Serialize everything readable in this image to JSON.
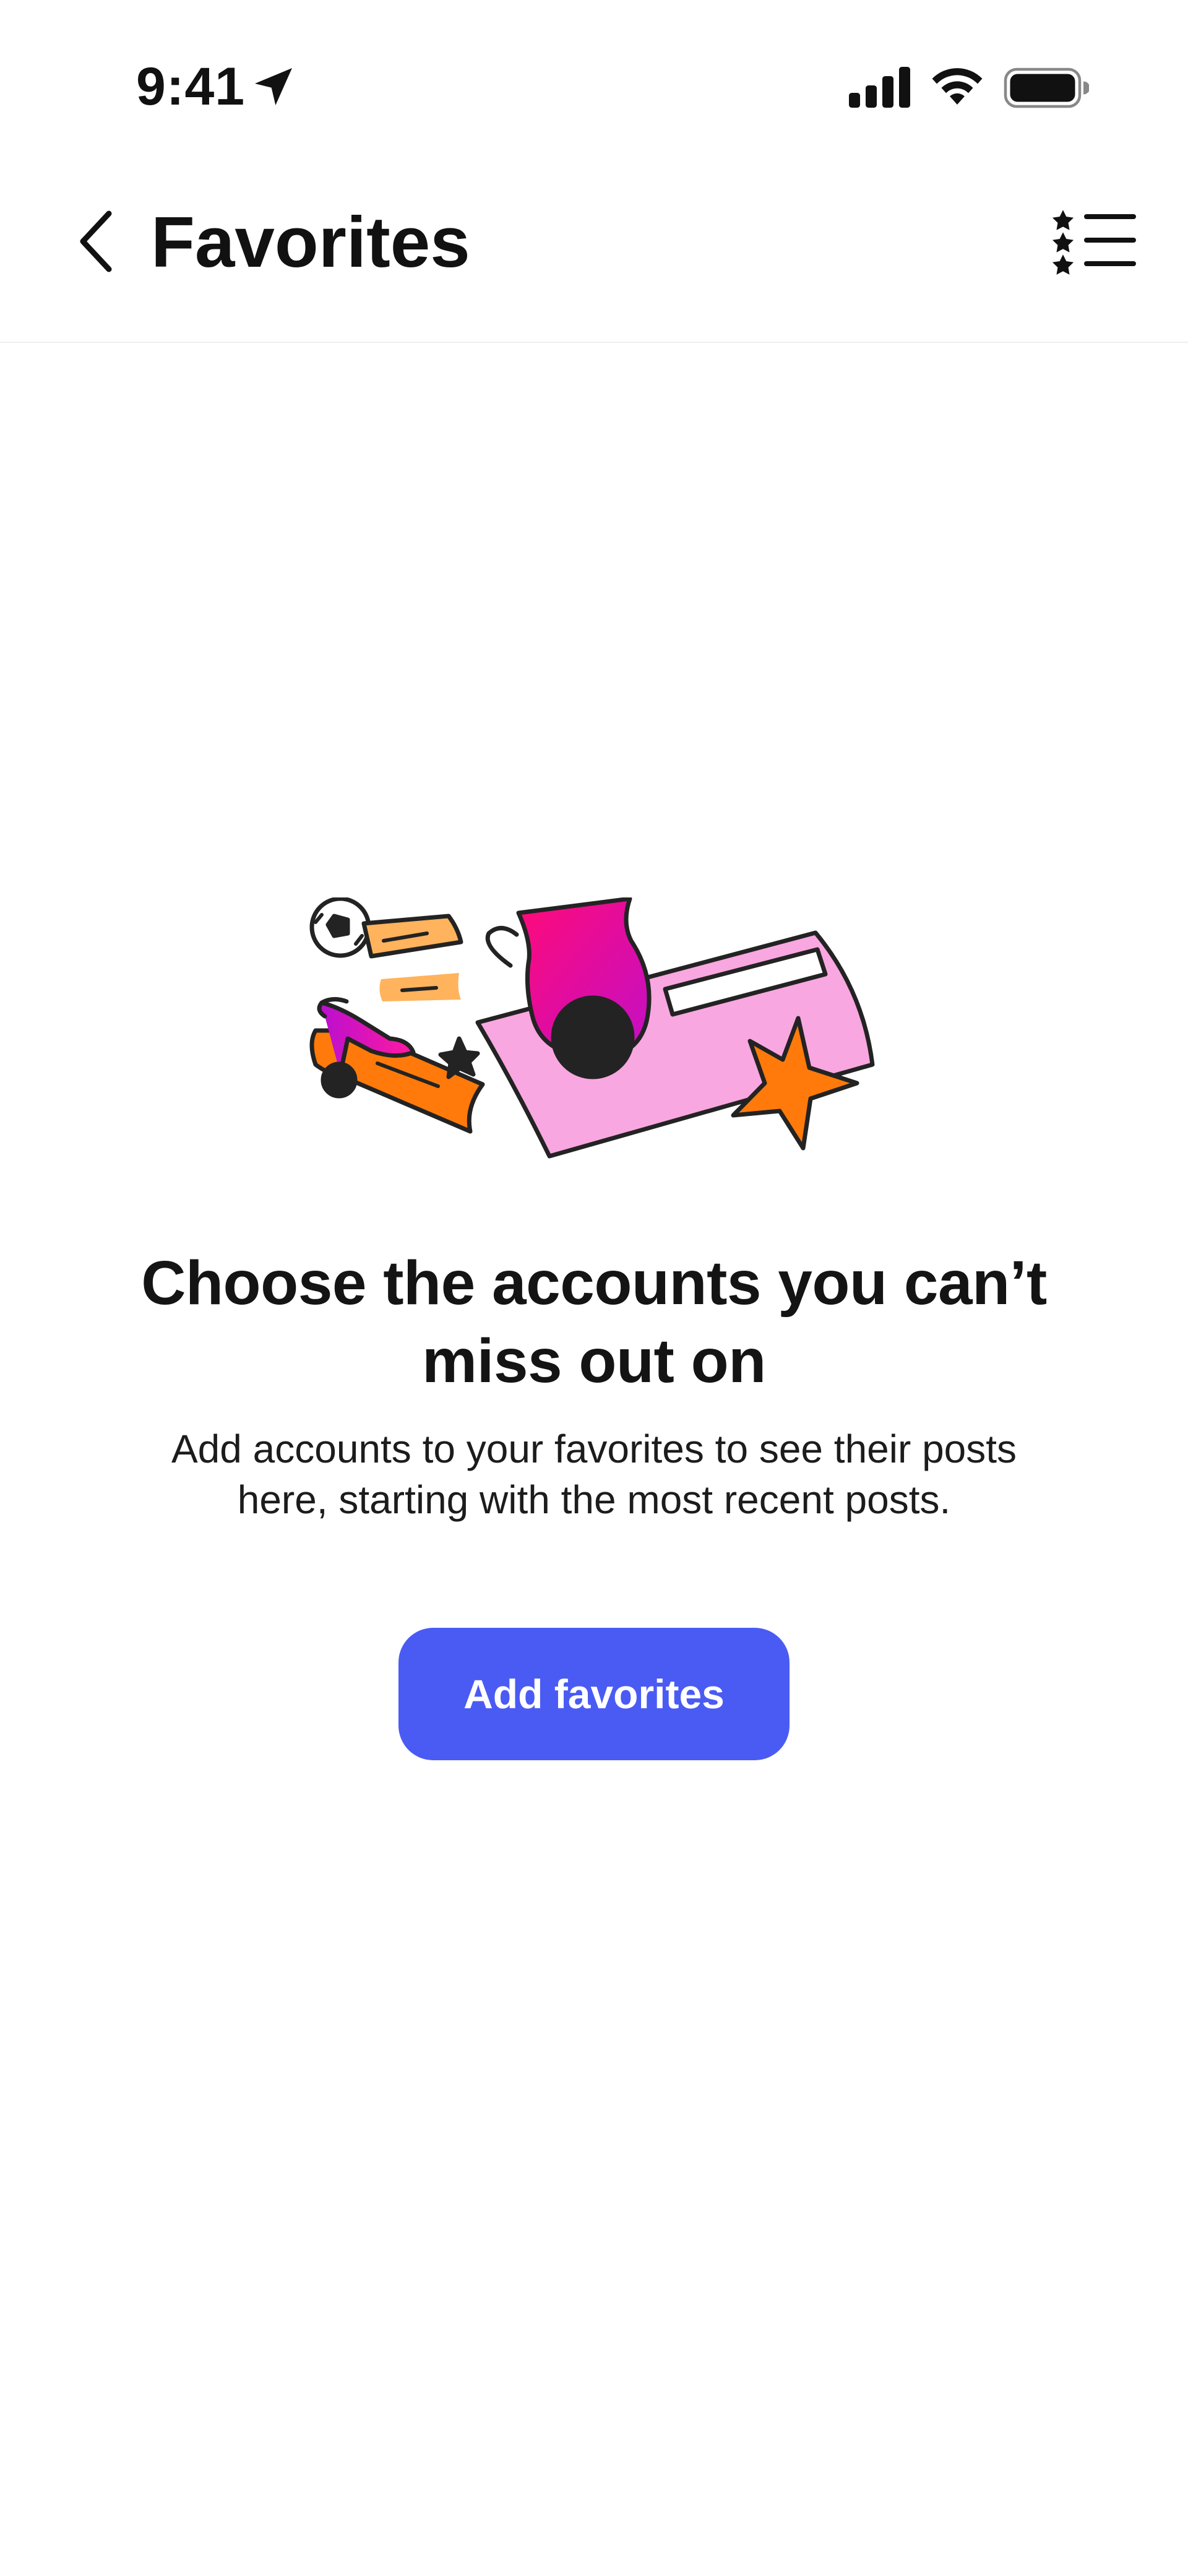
{
  "status_bar": {
    "time": "9:41",
    "icons": [
      "location-arrow-icon",
      "cellular-signal-icon",
      "wifi-icon",
      "battery-icon"
    ]
  },
  "nav": {
    "title": "Favorites",
    "back_icon": "chevron-left-icon",
    "list_icon": "starred-list-icon"
  },
  "empty_state": {
    "headline": "Choose the accounts you can’t miss out on",
    "body": "Add accounts to your favorites to see their posts here, starting with the most recent posts.",
    "button_label": "Add favorites",
    "illustration": "favorites-collage-illustration"
  },
  "colors": {
    "accent": "#4a5bf4",
    "pink": "#f9a7e0",
    "magenta": "#e0139b",
    "orange": "#ff7a0a",
    "light_orange": "#ffb35c",
    "ink": "#232323"
  }
}
